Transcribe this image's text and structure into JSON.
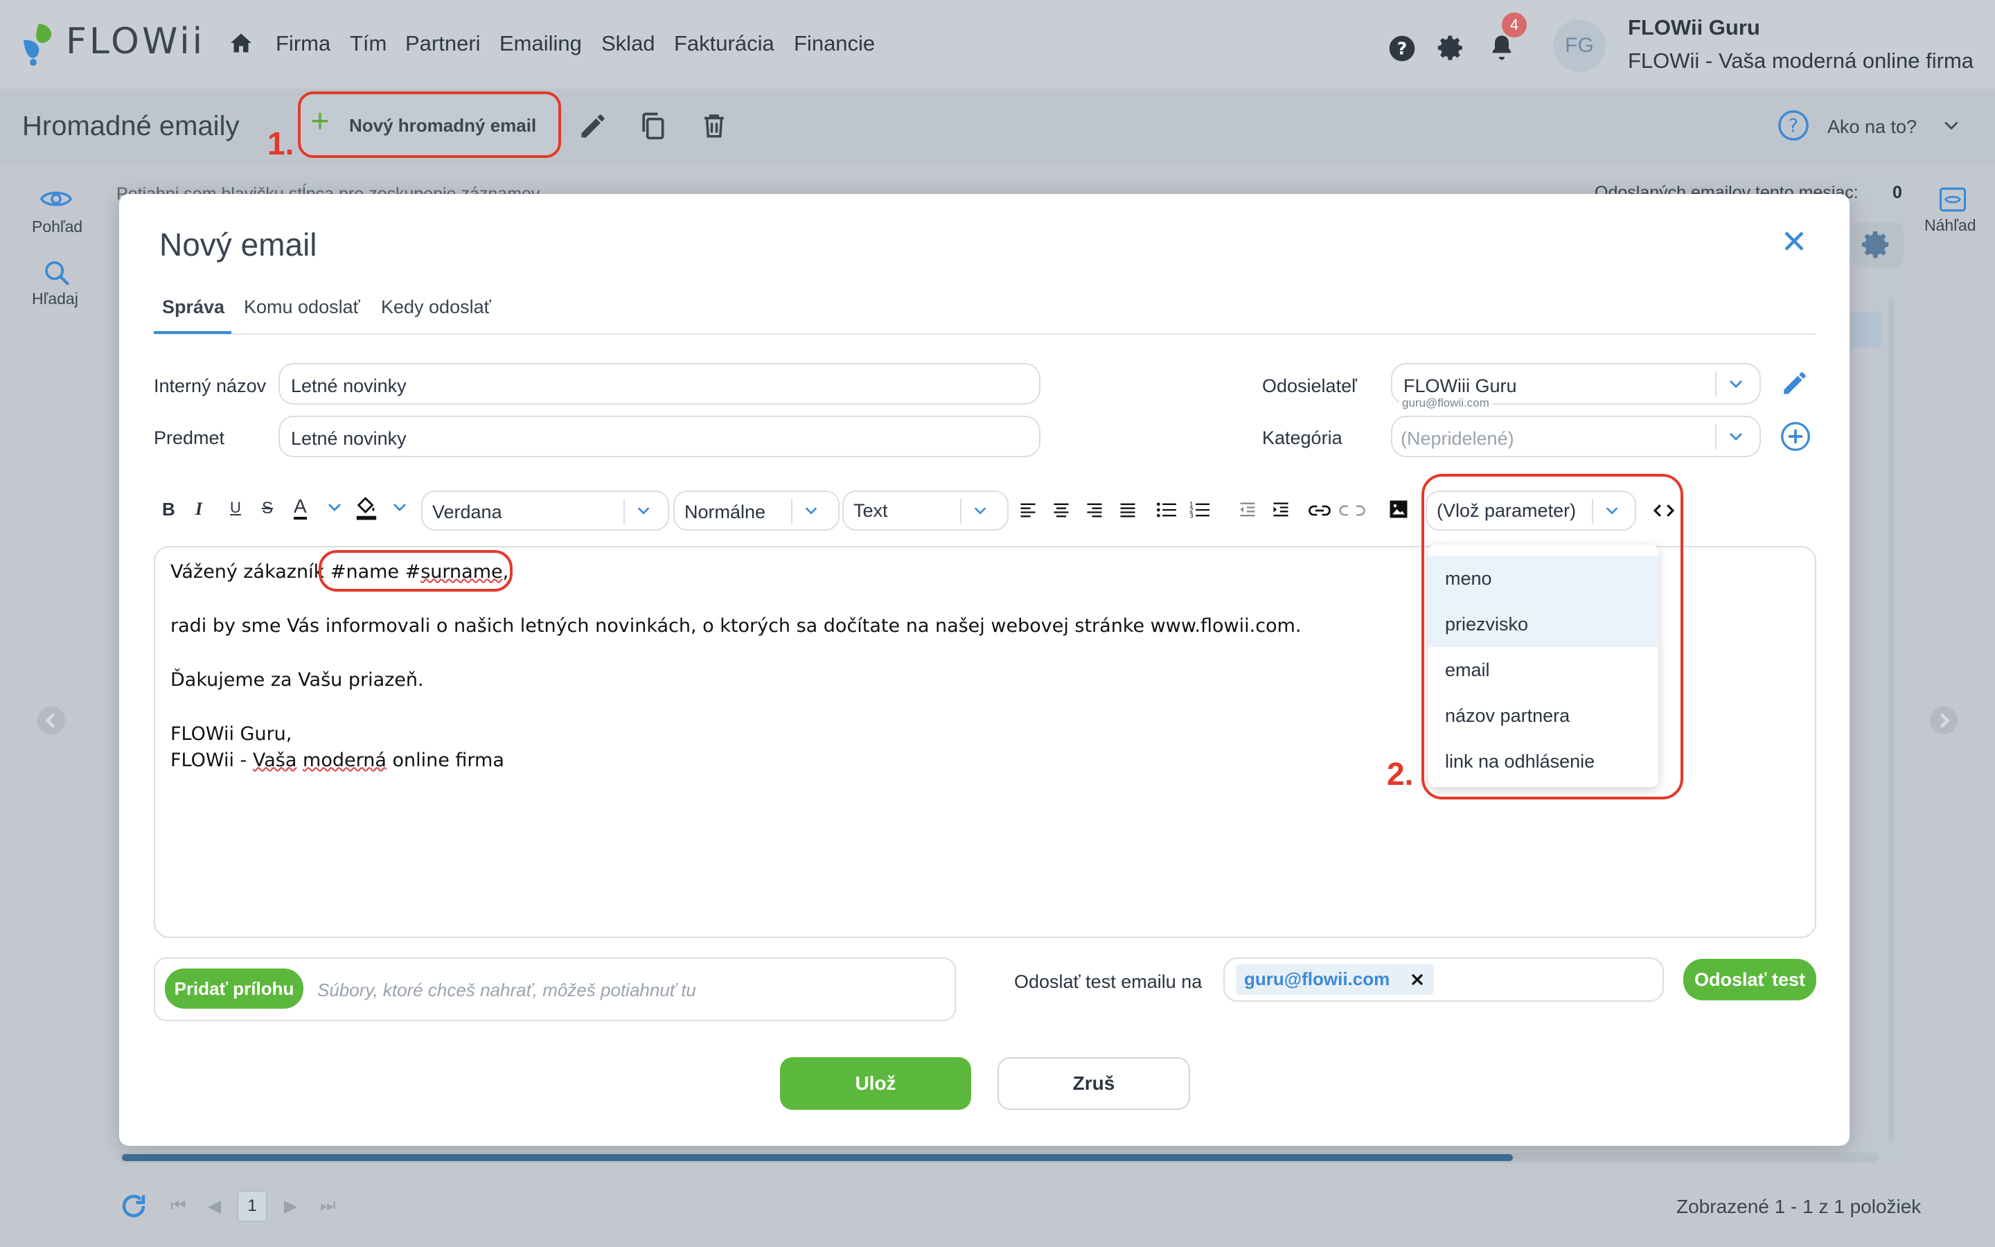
{
  "app": {
    "logo_text": "FLOWii",
    "nav": [
      "Firma",
      "Tím",
      "Partneri",
      "Emailing",
      "Sklad",
      "Fakturácia",
      "Financie"
    ],
    "notification_count": "4",
    "user_initials": "FG",
    "user_name": "FLOWii Guru",
    "user_company": "FLOWii - Vaša moderná online firma"
  },
  "subbar": {
    "page_title": "Hromadné emaily",
    "new_button_label": "Nový hromadný email",
    "annotation_1": "1.",
    "help_label": "Ako na to?"
  },
  "rail": {
    "left_items": [
      "Pohľad",
      "Hľadaj"
    ],
    "right_item": "Náhľad"
  },
  "background": {
    "group_hint": "Potiahni sem hlavičku stĺpca pre zoskupenie záznamov",
    "sent_count_label": "Odoslaných emailov tento mesiac:",
    "sent_count_value": "0",
    "pager_page": "1",
    "pager_summary": "Zobrazené 1 - 1 z 1 položiek"
  },
  "modal": {
    "title": "Nový email",
    "tabs": [
      "Správa",
      "Komu odoslať",
      "Kedy odoslať"
    ],
    "internal_name_label": "Interný názov",
    "internal_name_value": "Letné novinky",
    "subject_label": "Predmet",
    "subject_value": "Letné novinky",
    "sender_label": "Odosielateľ",
    "sender_value": "FLOWiii Guru",
    "sender_email": "guru@flowii.com",
    "category_label": "Kategória",
    "category_placeholder": "(Nepridelené)",
    "toolbar": {
      "bold": "B",
      "italic": "I",
      "underline": "U",
      "strike": "S",
      "font_color": "A",
      "font_family": "Verdana",
      "font_size": "Normálne",
      "format": "Text",
      "insert_param": "(Vlož parameter)"
    },
    "editor": {
      "greeting_prefix": "Vážený zákazník",
      "greeting_params": "#name #",
      "greeting_surname": "surname",
      "greeting_suffix": ",",
      "line2": "radi by sme Vás informovali o našich letných novinkách, o ktorých sa dočítate na našej webovej stránke www.flowii.com.",
      "line3": "Ďakujeme za Vašu priazeň.",
      "sign1": "FLOWii Guru,",
      "sign2_a": "FLOWii - ",
      "sign2_b": "Vaša",
      "sign2_c": " ",
      "sign2_d": "moderná",
      "sign2_e": " online firma"
    },
    "param_menu": [
      "meno",
      "priezvisko",
      "email",
      "názov partnera",
      "link na odhlásenie"
    ],
    "annotation_2": "2.",
    "attach_button": "Pridať prílohu",
    "attach_placeholder": "Súbory, ktoré chceš nahrať, môžeš potiahnuť tu",
    "test_label": "Odoslať test emailu na",
    "test_email_chip": "guru@flowii.com",
    "test_button": "Odoslať test",
    "save_button": "Ulož",
    "cancel_button": "Zruš"
  },
  "colors": {
    "accent_green": "#5cb83c",
    "accent_blue": "#3a8ad6",
    "annotation_red": "#e23a2a"
  }
}
